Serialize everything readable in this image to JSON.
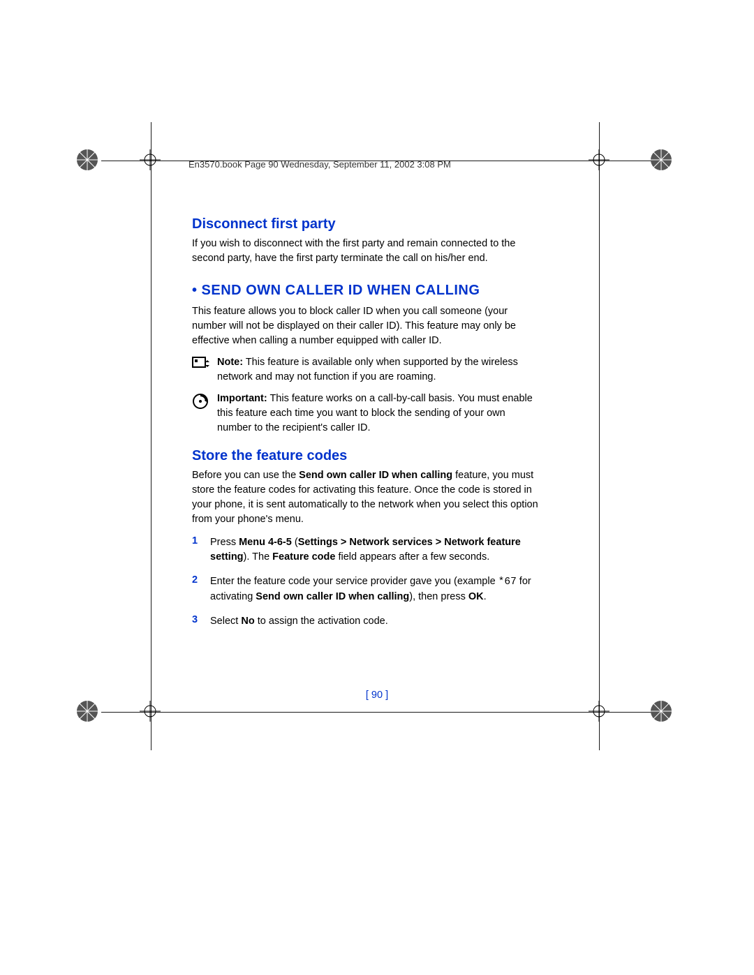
{
  "header": {
    "text": "En3570.book  Page 90  Wednesday, September 11, 2002  3:08 PM"
  },
  "section1": {
    "title": "Disconnect first party",
    "body": "If you wish to disconnect with the first party and remain connected to the second party, have the first party terminate the call on his/her end."
  },
  "section2": {
    "title": " • SEND OWN CALLER ID WHEN CALLING",
    "body": "This feature allows you to block caller ID when you call someone (your number will not be displayed on their caller ID). This feature may only be effective when calling a number equipped with caller ID.",
    "note_label": "Note:",
    "note_text": " This feature is available only when supported by the wireless network and may not function if you are roaming.",
    "important_label": "Important:",
    "important_text": " This feature works on a call-by-call basis. You must enable this feature each time you want to block the sending of your own number to the recipient's caller ID."
  },
  "section3": {
    "title": "Store the feature codes",
    "body_pre": "Before you can use the ",
    "body_bold1": "Send own caller ID when calling",
    "body_post": " feature, you must store the feature codes for activating this feature. Once the code is stored in your phone, it is sent automatically to the network when you select this option from your phone's menu.",
    "steps": [
      {
        "num": "1",
        "pre": "Press ",
        "b1": "Menu 4-6-5",
        "mid1": " (",
        "b2": "Settings > Network services > Network feature setting",
        "mid2": "). The ",
        "b3": "Feature code",
        "post": " field appears after a few seconds."
      },
      {
        "num": "2",
        "pre": "Enter the feature code your service provider gave you (example ",
        "code": "*67",
        "mid1": " for activating ",
        "b1": "Send own caller ID when calling",
        "mid2": "), then press ",
        "b2": "OK",
        "post": "."
      },
      {
        "num": "3",
        "pre": "Select ",
        "b1": "No",
        "post": " to assign the activation code."
      }
    ]
  },
  "page_number": "[ 90 ]"
}
